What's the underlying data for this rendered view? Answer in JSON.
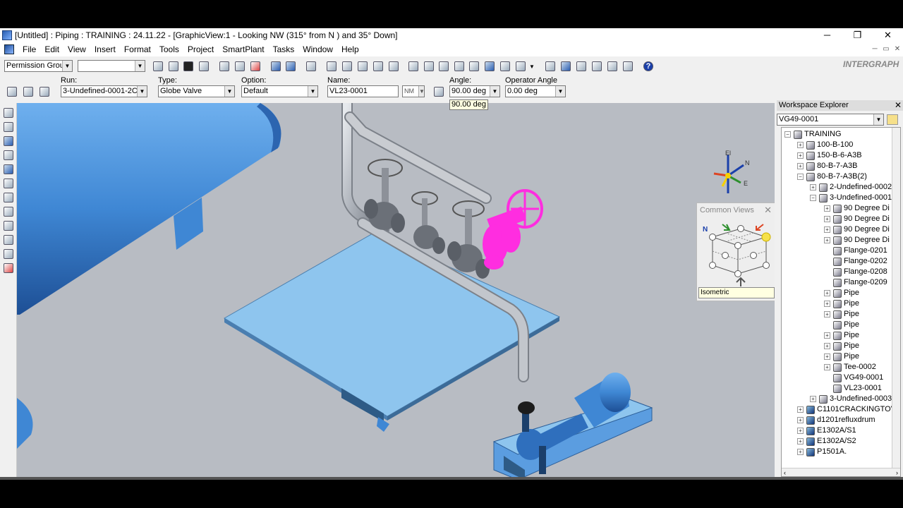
{
  "window": {
    "title": "[Untitled] : Piping : TRAINING : 24.11.22 - [GraphicView:1 - Looking NW (315° from N ) and 35° Down]",
    "controls": [
      "─",
      "❐",
      "✕"
    ]
  },
  "menu": {
    "items": [
      "File",
      "Edit",
      "View",
      "Insert",
      "Format",
      "Tools",
      "Project",
      "SmartPlant",
      "Tasks",
      "Window",
      "Help"
    ],
    "mdi": [
      "─",
      "▭",
      "✕"
    ]
  },
  "toolbar1": {
    "permission_group": "Permission Group",
    "active_combo": "",
    "brand": "INTERGRAPH"
  },
  "toolbar2": {
    "run_label": "Run:",
    "run_value": "3-Undefined-0001-2C0(",
    "type_label": "Type:",
    "type_value": "Globe Valve",
    "option_label": "Option:",
    "option_value": "Default",
    "name_label": "Name:",
    "name_value": "VL23-0001",
    "name_rule": "NM",
    "angle_label": "Angle:",
    "angle_value": "90.00 deg",
    "operator_angle_label": "Operator Angle",
    "operator_angle_value": "0.00 deg",
    "angle_tooltip": "90.00 deg"
  },
  "compass": {
    "el": "El",
    "n": "N",
    "e": "E"
  },
  "common_views": {
    "title": "Common Views",
    "close": "✕",
    "north": "N",
    "selected": "Isometric"
  },
  "workspace": {
    "title": "Workspace Explorer",
    "close": "✕",
    "filter": "VG49-0001",
    "tree": [
      {
        "label": "TRAINING",
        "exp": "−",
        "level": 0
      },
      {
        "label": "100-B-100",
        "exp": "+",
        "level": 1
      },
      {
        "label": "150-B-6-A3B",
        "exp": "+",
        "level": 1
      },
      {
        "label": "80-B-7-A3B",
        "exp": "+",
        "level": 1
      },
      {
        "label": "80-B-7-A3B(2)",
        "exp": "−",
        "level": 1
      },
      {
        "label": "2-Undefined-0002",
        "exp": "+",
        "level": 2
      },
      {
        "label": "3-Undefined-0001",
        "exp": "−",
        "level": 2
      },
      {
        "label": "90 Degree Di",
        "exp": "+",
        "level": 3
      },
      {
        "label": "90 Degree Di",
        "exp": "+",
        "level": 3
      },
      {
        "label": "90 Degree Di",
        "exp": "+",
        "level": 3
      },
      {
        "label": "90 Degree Di",
        "exp": "+",
        "level": 3
      },
      {
        "label": "Flange-0201",
        "exp": "",
        "level": 3
      },
      {
        "label": "Flange-0202",
        "exp": "",
        "level": 3
      },
      {
        "label": "Flange-0208",
        "exp": "",
        "level": 3
      },
      {
        "label": "Flange-0209",
        "exp": "",
        "level": 3
      },
      {
        "label": "Pipe",
        "exp": "+",
        "level": 3
      },
      {
        "label": "Pipe",
        "exp": "+",
        "level": 3
      },
      {
        "label": "Pipe",
        "exp": "+",
        "level": 3
      },
      {
        "label": "Pipe",
        "exp": "",
        "level": 3
      },
      {
        "label": "Pipe",
        "exp": "+",
        "level": 3
      },
      {
        "label": "Pipe",
        "exp": "+",
        "level": 3
      },
      {
        "label": "Pipe",
        "exp": "+",
        "level": 3
      },
      {
        "label": "Tee-0002",
        "exp": "+",
        "level": 3
      },
      {
        "label": "VG49-0001",
        "exp": "",
        "level": 3
      },
      {
        "label": "VL23-0001",
        "exp": "",
        "level": 3
      },
      {
        "label": "3-Undefined-0003",
        "exp": "+",
        "level": 2
      },
      {
        "label": "C1101CRACKINGTOV",
        "exp": "+",
        "level": 1,
        "eq": true
      },
      {
        "label": "d1201refluxdrum",
        "exp": "+",
        "level": 1,
        "eq": true
      },
      {
        "label": "E1302A/S1",
        "exp": "+",
        "level": 1,
        "eq": true
      },
      {
        "label": "E1302A/S2",
        "exp": "+",
        "level": 1,
        "eq": true
      },
      {
        "label": "P1501A.",
        "exp": "+",
        "level": 1,
        "eq": true
      }
    ],
    "scroll_left": "‹",
    "scroll_right": "›"
  },
  "colors": {
    "equipment": "#3f87d4",
    "slab": "#8ec5ee",
    "pipe": "#aeb3ba",
    "selected": "#ff2de0",
    "viewport_bg": "#b8bcc3"
  }
}
